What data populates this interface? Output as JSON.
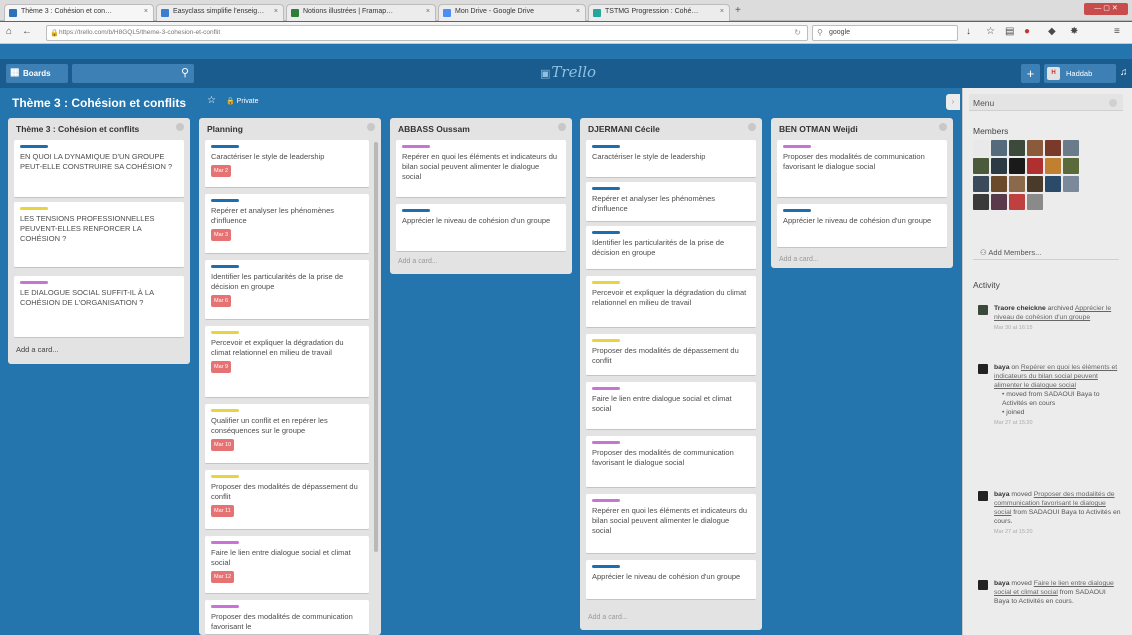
{
  "browser": {
    "tabs": [
      {
        "title": "Thème 3 : Cohésion et con…",
        "favicon": "#2c73b9"
      },
      {
        "title": "Easyclass simplifie l'enseig…",
        "favicon": "#3a7ed0"
      },
      {
        "title": "Notions illustrées | Framap…",
        "favicon": "#2f7f3b"
      },
      {
        "title": "Mon Drive - Google Drive",
        "favicon": "#4c8df6"
      },
      {
        "title": "TSTMG Progression : Cohé…",
        "favicon": "#26a69a"
      }
    ],
    "url": "https://trello.com/b/H8GQL5/theme-3-cohesion-et-conflit",
    "search_value": "google"
  },
  "header": {
    "boards_label": "Boards",
    "logo_text": "Trello",
    "user_initial": "H",
    "user_name": "Haddab"
  },
  "board": {
    "title": "Thème 3 : Cohésion et conflits",
    "privacy": "Private"
  },
  "lists": [
    {
      "title": "Thème 3 : Cohésion et conflits",
      "add_label": "Add a card...",
      "cards": [
        {
          "text": "EN QUOI LA DYNAMIQUE D'UN GROUPE PEUT-ELLE CONSTRUIRE SA COHÉSION ?",
          "label": "#1b6fb0"
        },
        {
          "text": "LES TENSIONS PROFESSIONNELLES PEUVENT-ELLES RENFORCER LA COHÉSION ?",
          "label": "#e8d43c"
        },
        {
          "text": "LE DIALOGUE SOCIAL SUFFIT-IL À LA COHÉSION DE L'ORGANISATION ?",
          "label": "#c774d4"
        }
      ]
    },
    {
      "title": "Planning",
      "cards": [
        {
          "text": "Caractériser le style de leadership",
          "label": "#1b6fb0",
          "badge": "Mar 2"
        },
        {
          "text": "Repérer et analyser les phénomènes d'influence",
          "label": "#1b6fb0",
          "badge": "Mar 3"
        },
        {
          "text": "Identifier les particularités de la prise de décision en groupe",
          "label": "#1b6fb0",
          "badge": "Mar 6"
        },
        {
          "text": "Percevoir et expliquer la dégradation du climat relationnel en milieu de travail",
          "label": "#e8d43c",
          "badge": "Mar 9"
        },
        {
          "text": "Qualifier un conflit et en repérer les conséquences sur le groupe",
          "label": "#e8d43c",
          "badge": "Mar 10"
        },
        {
          "text": "Proposer des modalités de dépassement du conflit",
          "label": "#e8d43c",
          "badge": "Mar 11"
        },
        {
          "text": "Faire le lien entre dialogue social et climat social",
          "label": "#c774d4",
          "badge": "Mar 12"
        },
        {
          "text": "Proposer des modalités de communication favorisant le",
          "label": "#c774d4"
        }
      ]
    },
    {
      "title": "ABBASS Oussam",
      "add_label": "Add a card...",
      "cards": [
        {
          "text": "Repérer en quoi les éléments et indicateurs du bilan social peuvent alimenter le dialogue social",
          "label": "#c774d4"
        },
        {
          "text": "Apprécier le niveau de cohésion d'un groupe",
          "label": "#1b6fb0"
        }
      ]
    },
    {
      "title": "DJERMANI Cécile",
      "add_label": "Add a card...",
      "cards": [
        {
          "text": "Caractériser le style de leadership",
          "label": "#1b6fb0"
        },
        {
          "text": "Repérer et analyser les phénomènes d'influence",
          "label": "#1b6fb0"
        },
        {
          "text": "Identifier les particularités de la prise de décision en groupe",
          "label": "#1b6fb0"
        },
        {
          "text": "Percevoir et expliquer la dégradation du climat relationnel en milieu de travail",
          "label": "#e8d43c"
        },
        {
          "text": "Proposer des modalités de dépassement du conflit",
          "label": "#e8d43c"
        },
        {
          "text": "Faire le lien entre dialogue social et climat social",
          "label": "#c774d4"
        },
        {
          "text": "Proposer des modalités de communication favorisant le dialogue social",
          "label": "#c774d4"
        },
        {
          "text": "Repérer en quoi les éléments et indicateurs du bilan social peuvent alimenter le dialogue social",
          "label": "#c774d4"
        },
        {
          "text": "Apprécier le niveau de cohésion d'un groupe",
          "label": "#1b6fb0"
        }
      ]
    },
    {
      "title": "BEN OTMAN Weijdi",
      "add_label": "Add a card...",
      "cards": [
        {
          "text": "Proposer des modalités de communication favorisant le dialogue social",
          "label": "#c774d4"
        },
        {
          "text": "Apprécier le niveau de cohésion d'un groupe",
          "label": "#1b6fb0"
        }
      ]
    }
  ],
  "drawer": {
    "menu_title": "Menu",
    "members_title": "Members",
    "add_members_label": "Add Members...",
    "activity_title": "Activity",
    "member_colors": [
      "#e9e9e9",
      "#556b7c",
      "#3b4a3a",
      "#8a5a3a",
      "#7a3a2a",
      "#6a7c8a",
      "#4a5a3a",
      "#2c3a44",
      "#1a1a1a",
      "#b03030",
      "#c08030",
      "#5a6a3a",
      "#3a4a5a",
      "#6a4a2a",
      "#8a6a4a",
      "#4a3a2a",
      "#2a4a6a",
      "#7a8a9a",
      "#3a3a3a",
      "#5a3a4a",
      "#c04040",
      "#8a8a8a"
    ],
    "activities": [
      {
        "who": "Traore cheickne",
        "pre": " archived ",
        "link": "Apprécier le niveau de cohésion d'un groupe",
        "post": "",
        "subs": [],
        "time": "Mar 30 at 16:15",
        "avatar": "#3a4a3a"
      },
      {
        "who": "baya",
        "pre": " on ",
        "link": "Repérer en quoi les éléments et indicateurs du bilan social peuvent alimenter le dialogue social",
        "post": "",
        "subs": [
          "• moved from SADAOUI Baya to Activités en cours",
          "• joined"
        ],
        "time": "Mar 27 at 15:20",
        "avatar": "#222222"
      },
      {
        "who": "baya",
        "pre": " moved ",
        "link": "Proposer des modalités de communication favorisant le dialogue social",
        "post": " from SADAOUI Baya to Activités en cours.",
        "subs": [],
        "time": "Mar 27 at 15:20",
        "avatar": "#222222"
      },
      {
        "who": "baya",
        "pre": " moved ",
        "link": "Faire le lien entre dialogue social et climat social",
        "post": " from SADAOUI Baya to Activités en cours.",
        "subs": [],
        "time": "Mar 27 at 15:20",
        "avatar": "#222222"
      }
    ]
  }
}
